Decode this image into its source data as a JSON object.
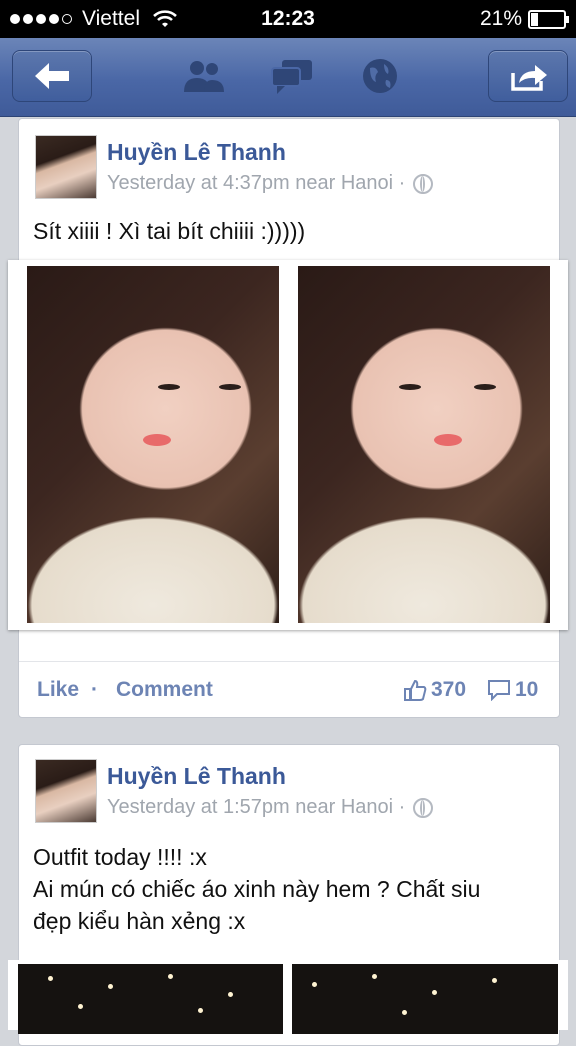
{
  "status_bar": {
    "carrier": "Viettel",
    "time": "12:23",
    "battery_pct": "21%",
    "battery_level": 0.21,
    "signal_bars": 4,
    "signal_total": 5
  },
  "nav": {
    "icons": [
      "back-arrow-icon",
      "friends-icon",
      "messages-icon",
      "globe-icon",
      "share-icon"
    ]
  },
  "posts": [
    {
      "author": "Huyền Lê Thanh",
      "meta": "Yesterday at 4:37pm near Hanoi ·",
      "text": "Sít xiiii ! Xì tai bít chiiii :)))))",
      "like_label": "Like",
      "comment_label": "Comment",
      "separator": "·",
      "likes": "370",
      "comments": "10"
    },
    {
      "author": "Huyền Lê Thanh",
      "meta": "Yesterday at 1:57pm near Hanoi ·",
      "text_lines": [
        "Outfit today !!!! :x",
        "Ai mún có chiếc áo xinh này hem ? Chất siu",
        "đẹp kiểu hàn xẻng :x"
      ]
    }
  ],
  "colors": {
    "nav_blue": "#4a67a6",
    "link_blue": "#3b5998",
    "action_blue": "#6d84b4",
    "meta_gray": "#a0a6ae",
    "background": "#d3d6db"
  }
}
